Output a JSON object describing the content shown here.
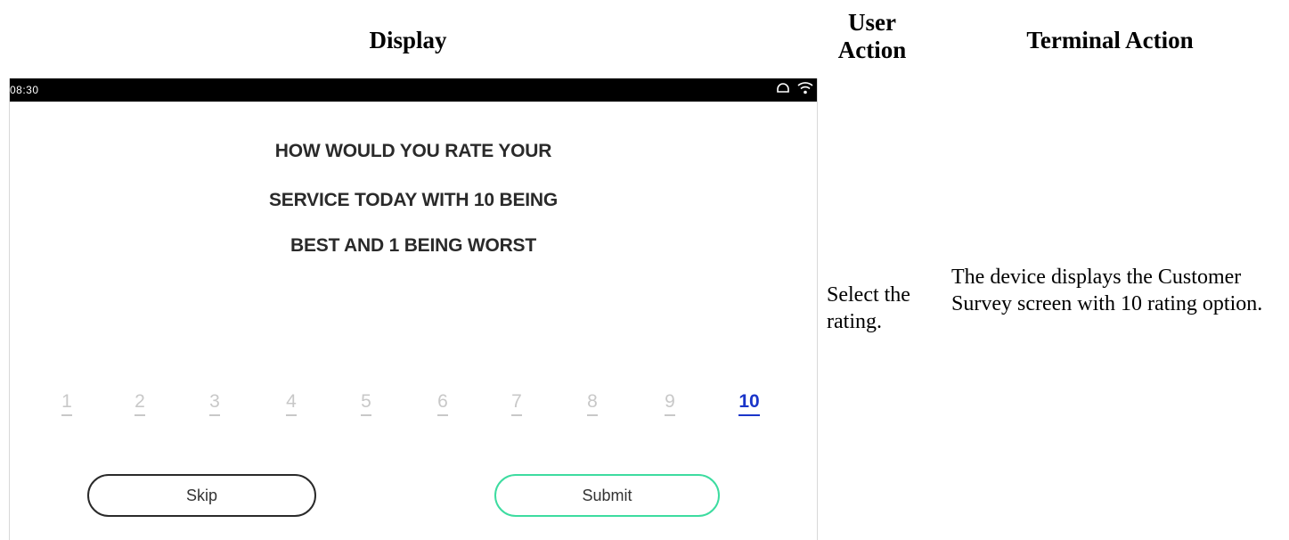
{
  "table": {
    "headers": {
      "display": "Display",
      "user_action": "User Action",
      "terminal_action": "Terminal Action"
    },
    "row": {
      "user_action": "Select the rating.",
      "terminal_action": "The device displays the Customer Survey screen with 10 rating option."
    }
  },
  "device": {
    "status_bar": {
      "time": "08:30",
      "icons": [
        "cloud-icon",
        "wifi-icon"
      ]
    },
    "question_lines": [
      "HOW WOULD YOU RATE YOUR",
      "SERVICE TODAY WITH 10 BEING",
      "BEST AND 1 BEING WORST"
    ],
    "ratings": [
      "1",
      "2",
      "3",
      "4",
      "5",
      "6",
      "7",
      "8",
      "9",
      "10"
    ],
    "selected_rating": "10",
    "buttons": {
      "skip": "Skip",
      "submit": "Submit"
    },
    "colors": {
      "selected_rating": "#1a35c9",
      "unselected_rating": "#c8c8c8",
      "submit_border": "#3ddca0",
      "skip_border": "#2a2a2a",
      "status_bar": "#000000"
    }
  }
}
